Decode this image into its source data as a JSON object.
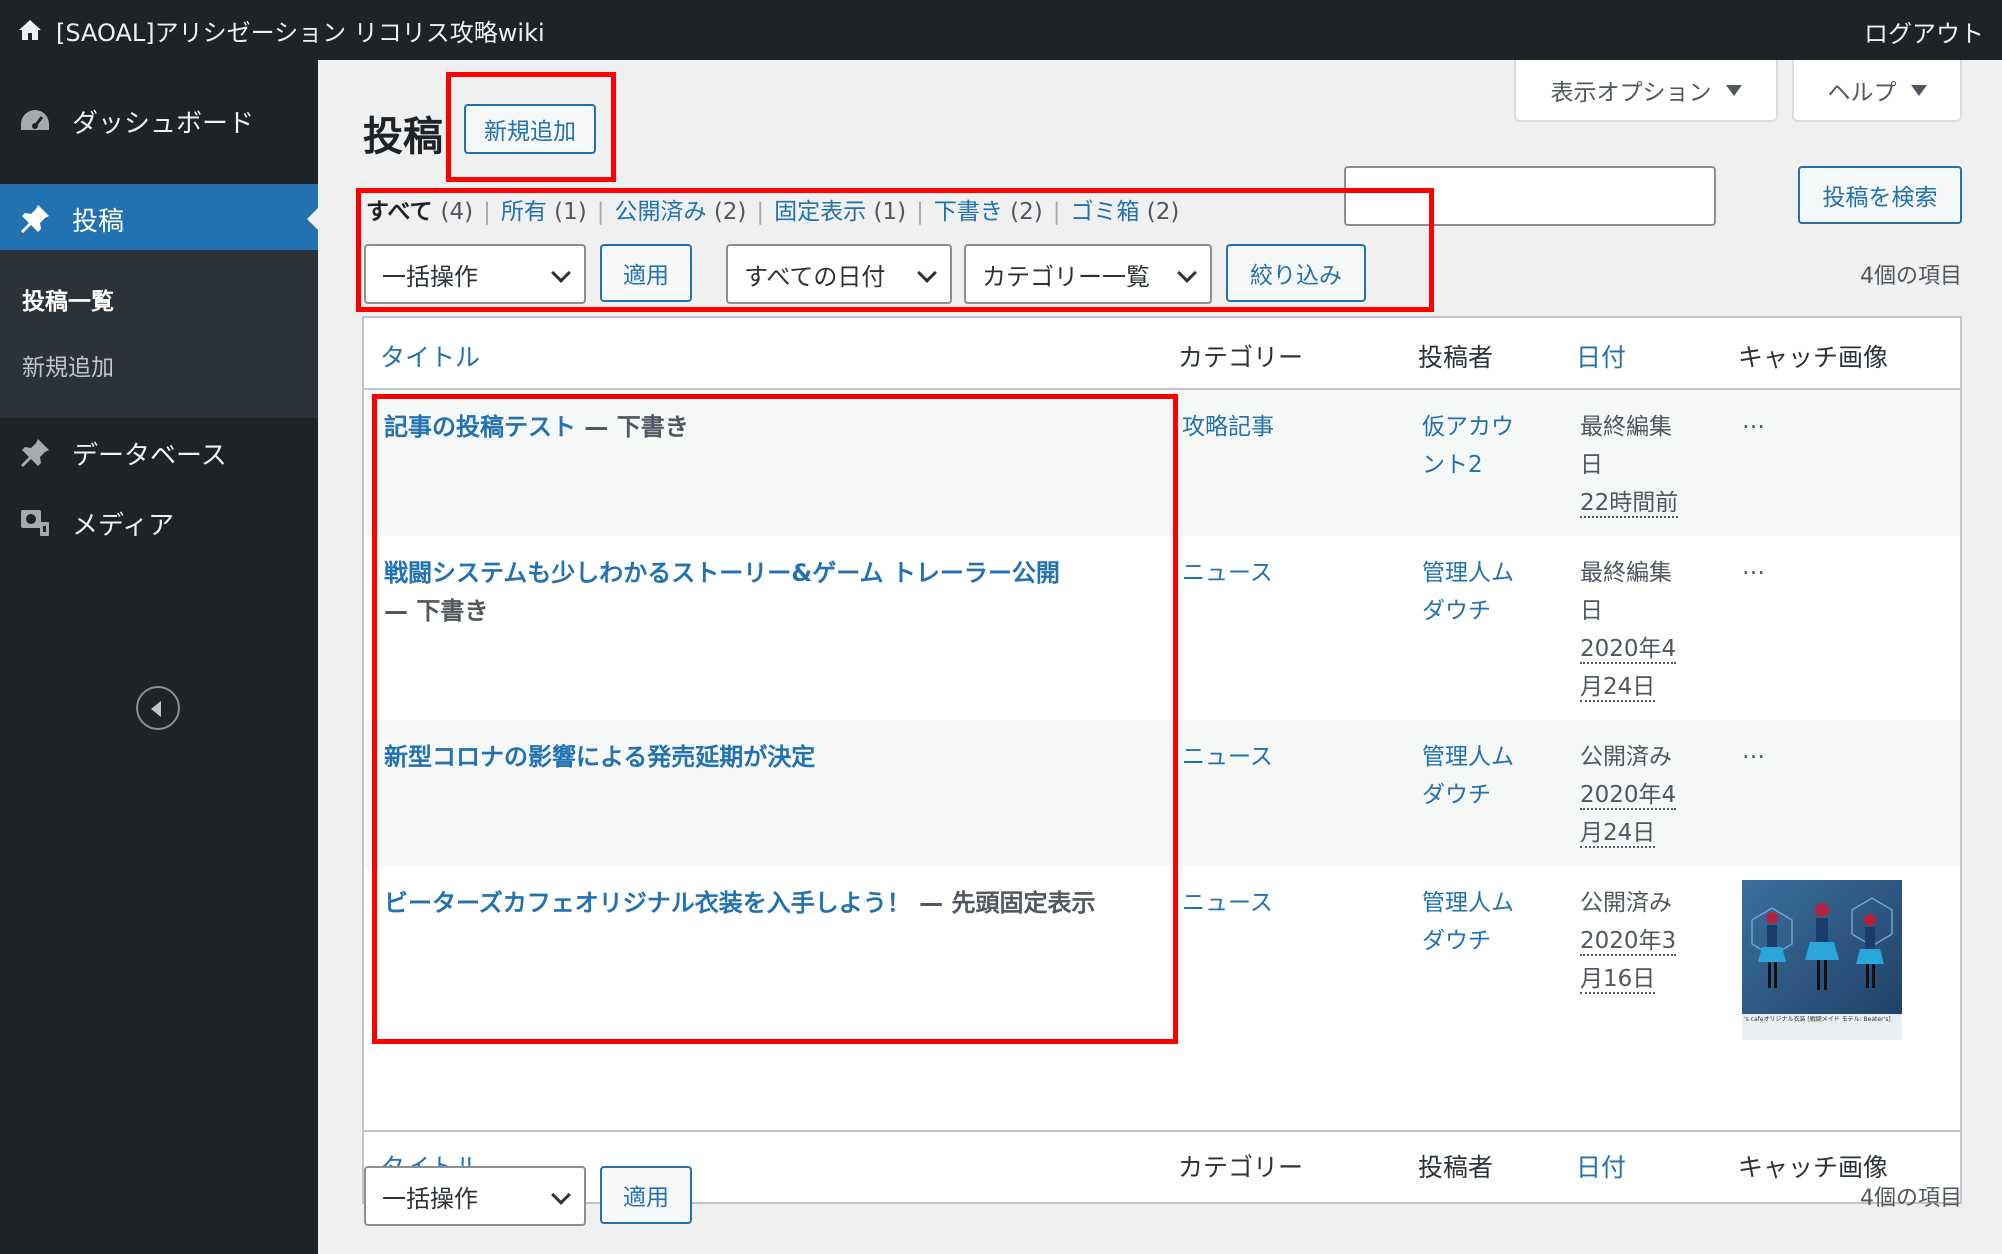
{
  "adminbar": {
    "site_name": "[SAOAL]アリシゼーション リコリス攻略wiki",
    "logout": "ログアウト"
  },
  "sidebar": {
    "items": [
      {
        "label": "ダッシュボード",
        "icon": "dashboard-icon"
      },
      {
        "label": "投稿",
        "icon": "pin-icon",
        "current": true
      },
      {
        "label": "データベース",
        "icon": "pin-icon"
      },
      {
        "label": "メディア",
        "icon": "media-icon"
      }
    ],
    "submenu": [
      {
        "label": "投稿一覧",
        "active": true
      },
      {
        "label": "新規追加"
      }
    ]
  },
  "header": {
    "screen_options": "表示オプション",
    "help": "ヘルプ",
    "page_title": "投稿",
    "add_new": "新規追加",
    "search_button": "投稿を検索"
  },
  "views": [
    {
      "label": "すべて",
      "count": "(4)",
      "current": true
    },
    {
      "label": "所有",
      "count": "(1)"
    },
    {
      "label": "公開済み",
      "count": "(2)"
    },
    {
      "label": "固定表示",
      "count": "(1)"
    },
    {
      "label": "下書き",
      "count": "(2)"
    },
    {
      "label": "ゴミ箱",
      "count": "(2)"
    }
  ],
  "filters": {
    "bulk_action": "一括操作",
    "apply": "適用",
    "all_dates": "すべての日付",
    "all_categories": "カテゴリー一覧",
    "filter_button": "絞り込み",
    "items_count": "4個の項目"
  },
  "table": {
    "columns": {
      "title": "タイトル",
      "category": "カテゴリー",
      "author": "投稿者",
      "date": "日付",
      "thumbnail": "キャッチ画像"
    },
    "rows": [
      {
        "title": "記事の投稿テスト",
        "state": " — 下書き",
        "category": "攻略記事",
        "author": "仮アカウント2",
        "date_status": "最終編集日",
        "date_value": "22時間前",
        "thumbnail": "…"
      },
      {
        "title": "戦闘システムも少しわかるストーリー&ゲーム トレーラー公開",
        "state": " — 下書き",
        "category": "ニュース",
        "author": "管理人ムダウチ",
        "date_status": "最終編集日",
        "date_value": "2020年4月24日",
        "thumbnail": "…"
      },
      {
        "title": "新型コロナの影響による発売延期が決定",
        "state": "",
        "category": "ニュース",
        "author": "管理人ムダウチ",
        "date_status": "公開済み",
        "date_value": "2020年4月24日",
        "thumbnail": "…"
      },
      {
        "title": "ビーターズカフェオリジナル衣装を入手しよう！",
        "state": " — 先頭固定表示",
        "category": "ニュース",
        "author": "管理人ムダウチ",
        "date_status": "公開済み",
        "date_value": "2020年3月16日",
        "thumbnail_caption": "'s cafeオリジナル衣装 [戦闘メイド モデル: Beater's]"
      }
    ]
  },
  "bottom": {
    "bulk_action": "一括操作",
    "apply": "適用",
    "items_count": "4個の項目"
  },
  "colors": {
    "admin_dark": "#1d2327",
    "accent": "#2271b1",
    "highlight": "#ff0000"
  }
}
